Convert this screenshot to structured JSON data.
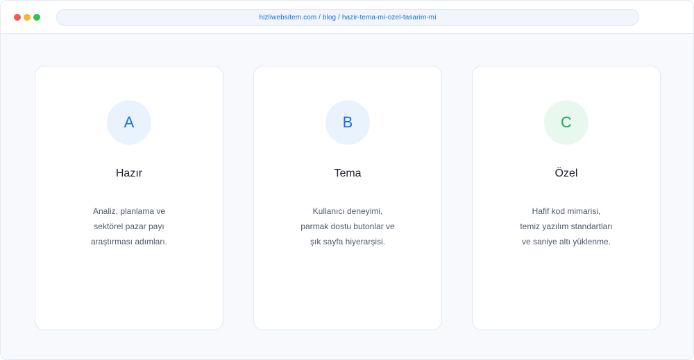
{
  "browser": {
    "url": "hizliwebsitem.com / blog / hazir-tema-mi-ozel-tasarim-mi",
    "url_color": "#1a6fd8",
    "controls": [
      {
        "name": "close",
        "color": "#ee5b52"
      },
      {
        "name": "minimize",
        "color": "#f5b72e"
      },
      {
        "name": "zoom",
        "color": "#31c34a"
      }
    ]
  },
  "cards": [
    {
      "badge": "A",
      "badge_color": "#1a6fd8",
      "badge_bg": "#e9f2fd",
      "title": "Hazır",
      "description": [
        "Analiz, planlama ve",
        "sektörel pazar payı",
        "araştırması adımları."
      ]
    },
    {
      "badge": "B",
      "badge_color": "#1a6fd8",
      "badge_bg": "#e9f2fd",
      "title": "Tema",
      "description": [
        "Kullanıcı deneyimi,",
        "parmak dostu butonlar ve",
        "şık sayfa hiyerarşisi."
      ]
    },
    {
      "badge": "C",
      "badge_color": "#1fa954",
      "badge_bg": "#e8f8ee",
      "title": "Özel",
      "description": [
        "Hafif kod mimarisi,",
        "temiz yazılım standartları",
        "ve saniye altı yüklenme."
      ]
    }
  ]
}
